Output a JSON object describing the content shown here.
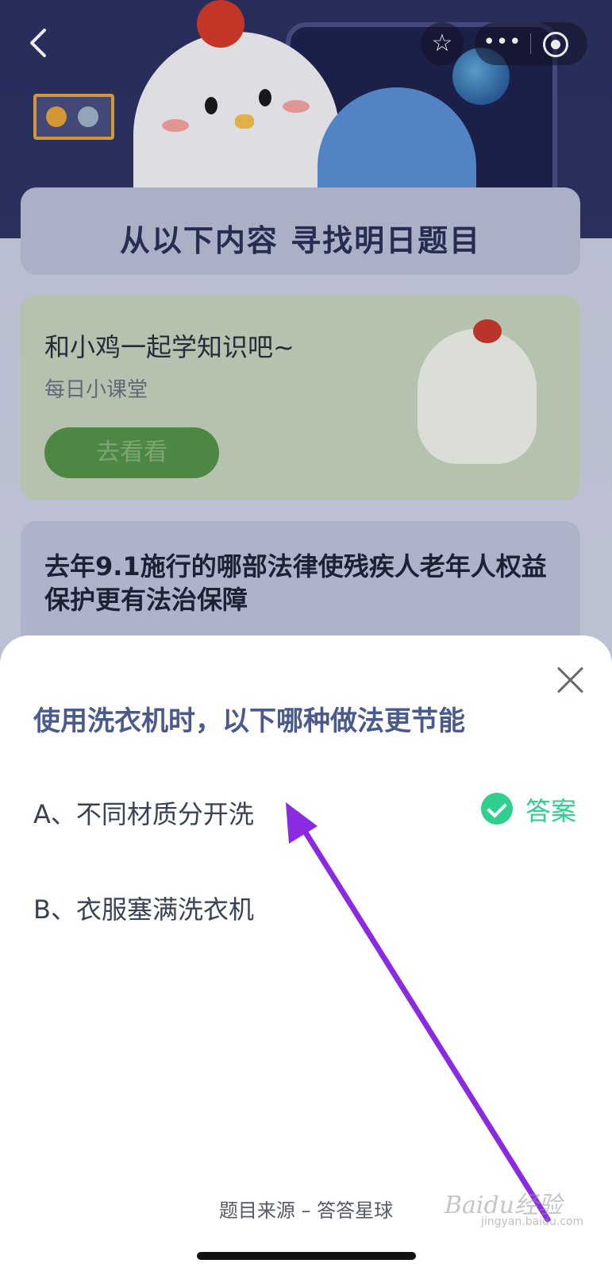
{
  "banner": {
    "heading": "从以下内容  寻找明日题目"
  },
  "learn_card": {
    "title": "和小鸡一起学知识吧~",
    "subtitle": "每日小课堂",
    "button": "去看看"
  },
  "question_card": {
    "text": "去年9.1施行的哪部法律使残疾人老年人权益保护更有法治保障"
  },
  "sheet": {
    "question": "使用洗衣机时，以下哪种做法更节能",
    "options": [
      {
        "label": "A、不同材质分开洗",
        "is_answer": true
      },
      {
        "label": "B、衣服塞满洗衣机",
        "is_answer": false
      }
    ],
    "answer_label": "答案",
    "source": "题目来源 – 答答星球"
  },
  "watermark": {
    "brand": "Baidu经验",
    "url": "jingyan.baidu.com"
  },
  "colors": {
    "accent_green": "#2fcf8d",
    "title_blue": "#4a5a8c",
    "annotation_arrow": "#8a2be2"
  }
}
